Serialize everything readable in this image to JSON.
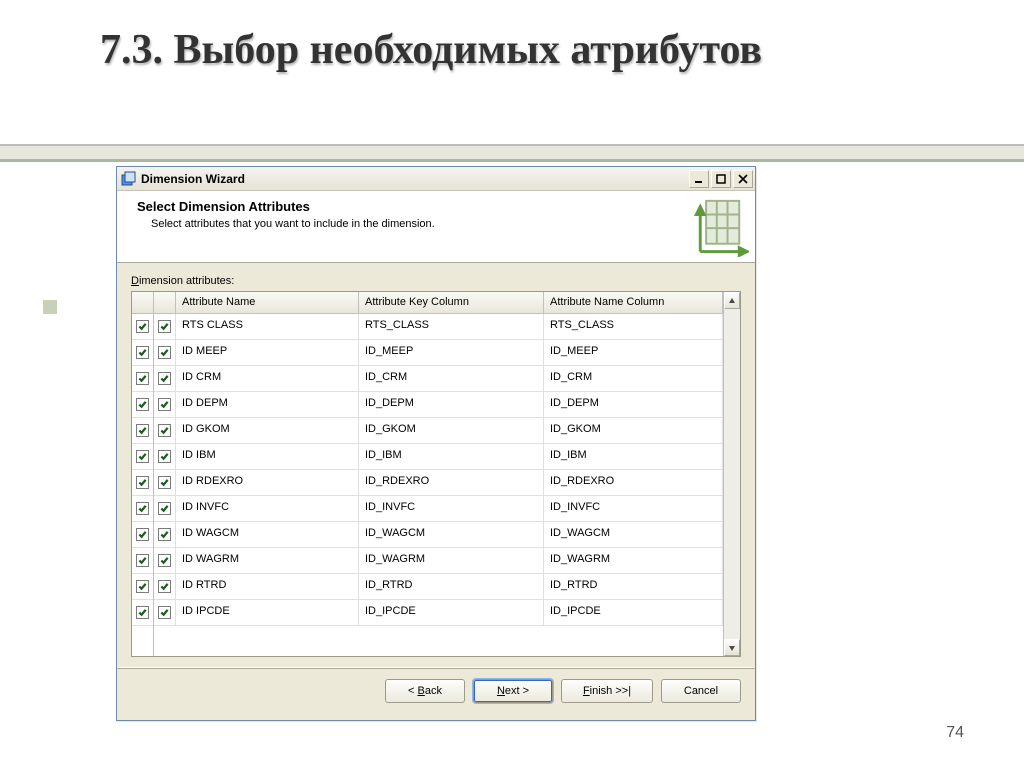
{
  "slide": {
    "title": "7.3. Выбор необходимых атрибутов",
    "page_number": "74"
  },
  "dialog": {
    "title": "Dimension Wizard",
    "header_title": "Select Dimension Attributes",
    "header_subtitle": "Select attributes that you want to include in the dimension.",
    "section_prefix": "D",
    "section_rest": "imension attributes:",
    "columns": {
      "name": "Attribute Name",
      "key": "Attribute Key Column",
      "namecol": "Attribute Name Column"
    },
    "rows": [
      {
        "checked": true,
        "name": "RTS CLASS",
        "key": "RTS_CLASS",
        "namecol": "RTS_CLASS"
      },
      {
        "checked": true,
        "name": "ID MEEP",
        "key": "ID_MEEP",
        "namecol": "ID_MEEP"
      },
      {
        "checked": true,
        "name": "ID CRM",
        "key": "ID_CRM",
        "namecol": "ID_CRM"
      },
      {
        "checked": true,
        "name": "ID DEPM",
        "key": "ID_DEPM",
        "namecol": "ID_DEPM"
      },
      {
        "checked": true,
        "name": "ID GKOM",
        "key": "ID_GKOM",
        "namecol": "ID_GKOM"
      },
      {
        "checked": true,
        "name": "ID IBM",
        "key": "ID_IBM",
        "namecol": "ID_IBM"
      },
      {
        "checked": true,
        "name": "ID RDEXRO",
        "key": "ID_RDEXRO",
        "namecol": "ID_RDEXRO"
      },
      {
        "checked": true,
        "name": "ID INVFC",
        "key": "ID_INVFC",
        "namecol": "ID_INVFC"
      },
      {
        "checked": true,
        "name": "ID WAGCM",
        "key": "ID_WAGCM",
        "namecol": "ID_WAGCM"
      },
      {
        "checked": true,
        "name": "ID WAGRM",
        "key": "ID_WAGRM",
        "namecol": "ID_WAGRM"
      },
      {
        "checked": true,
        "name": "ID RTRD",
        "key": "ID_RTRD",
        "namecol": "ID_RTRD"
      },
      {
        "checked": true,
        "name": "ID IPCDE",
        "key": "ID_IPCDE",
        "namecol": "ID_IPCDE"
      }
    ],
    "buttons": {
      "back_prefix": "< ",
      "back_u": "B",
      "back_rest": "ack",
      "next_u": "N",
      "next_rest": "ext >",
      "finish_u": "F",
      "finish_rest": "inish >>|",
      "cancel": "Cancel"
    }
  }
}
